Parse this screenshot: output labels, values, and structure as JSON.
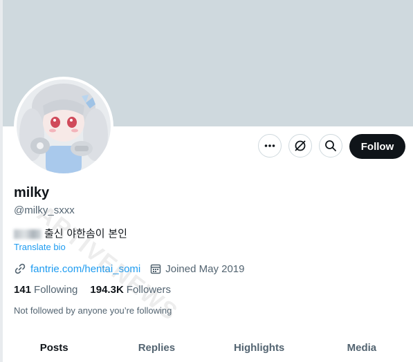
{
  "profile": {
    "name": "milky",
    "handle": "@milky_sxxx",
    "bio_text": "출신 야한솜이 본인",
    "translate_label": "Translate bio",
    "link_text": "fantrie.com/hentai_somi",
    "joined_text": "Joined May 2019",
    "following_count": "141",
    "following_label": "Following",
    "followers_count": "194.3K",
    "followers_label": "Followers",
    "not_followed_text": "Not followed by anyone you’re following"
  },
  "actions": {
    "follow_label": "Follow",
    "icons": [
      "more-icon",
      "grok-icon",
      "search-icon"
    ]
  },
  "tabs": [
    {
      "label": "Posts",
      "active": true
    },
    {
      "label": "Replies",
      "active": false
    },
    {
      "label": "Highlights",
      "active": false
    },
    {
      "label": "Media",
      "active": false
    }
  ],
  "watermark": "ARTIVENEWS",
  "colors": {
    "banner": "#cfd9de",
    "link": "#1d9bf0",
    "text": "#0f1419",
    "muted": "#536471",
    "follow_bg": "#0f1419"
  }
}
